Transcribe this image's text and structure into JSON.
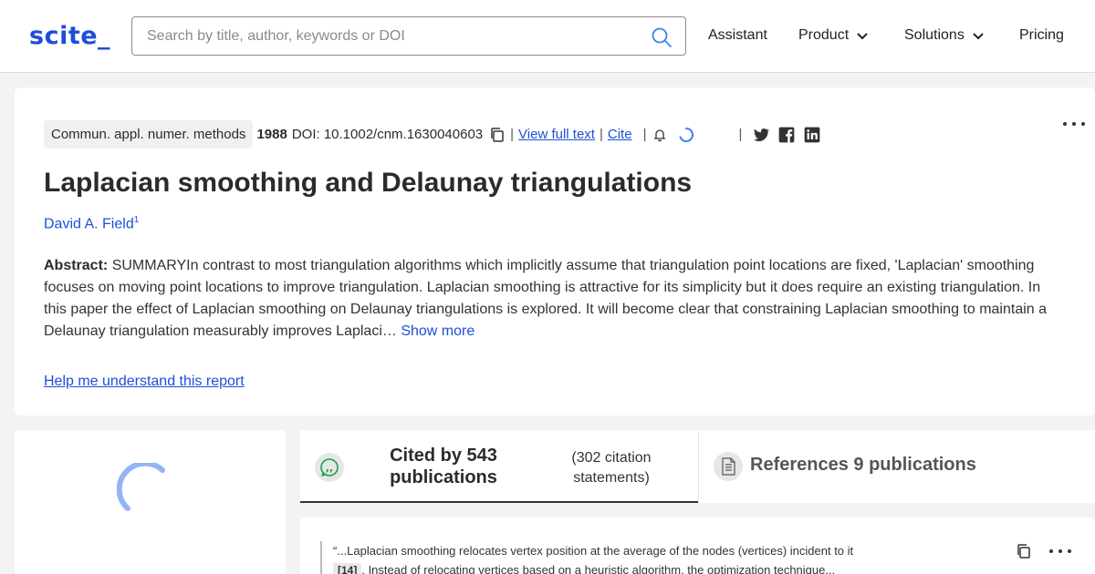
{
  "header": {
    "logo": "scite_",
    "search_placeholder": "Search by title, author, keywords or DOI",
    "nav": [
      {
        "label": "Assistant"
      },
      {
        "label": "Product"
      },
      {
        "label": "Solutions"
      },
      {
        "label": "Pricing"
      }
    ]
  },
  "paper": {
    "journal": "Commun. appl. numer. methods",
    "year": "1988",
    "doi": "DOI: 10.1002/cnm.1630040603",
    "view_full_text": "View full text",
    "cite": "Cite",
    "separator": "|",
    "title": "Laplacian smoothing and Delaunay triangulations",
    "author": "David A. Field",
    "author_sup": "1",
    "abstract_label": "Abstract:",
    "abstract_text": "SUMMARYIn contrast to most triangulation algorithms which implicitly assume that triangulation point locations are fixed, 'Laplacian' smoothing focuses on moving point locations to improve triangulation. Laplacian smoothing is attractive for its simplicity but it does require an existing triangulation. In this paper the effect of Laplacian smoothing on Delaunay triangulations is explored. It will become clear that constraining Laplacian smoothing to maintain a Delaunay triangulation measurably improves Laplaci…",
    "show_more": "Show more",
    "help_link": "Help me understand this report"
  },
  "tabs": {
    "cited_label": "Cited by 543 publications",
    "cited_sub": "(302 citation statements)",
    "refs_label": "References 9 publications"
  },
  "citation": {
    "quote_text": "“...Laplacian smoothing relocates vertex position at the average of the nodes (vertices) incident to it",
    "ref_tag": "[14]",
    "quote_text_2": ". Instead of relocating vertices based on a heuristic algorithm, the optimization technique..."
  },
  "colors": {
    "accent": "#1d4ed8",
    "text": "#2b2b2b",
    "background": "#f3f3f3"
  },
  "icons": {
    "search": "search-icon",
    "copy": "copy-icon",
    "bell": "bell-icon",
    "twitter": "twitter-icon",
    "facebook": "facebook-icon",
    "linkedin": "linkedin-icon",
    "more": "more-icon",
    "cite_badge": "speech-bubble-quote-icon",
    "ref_badge": "document-icon"
  }
}
